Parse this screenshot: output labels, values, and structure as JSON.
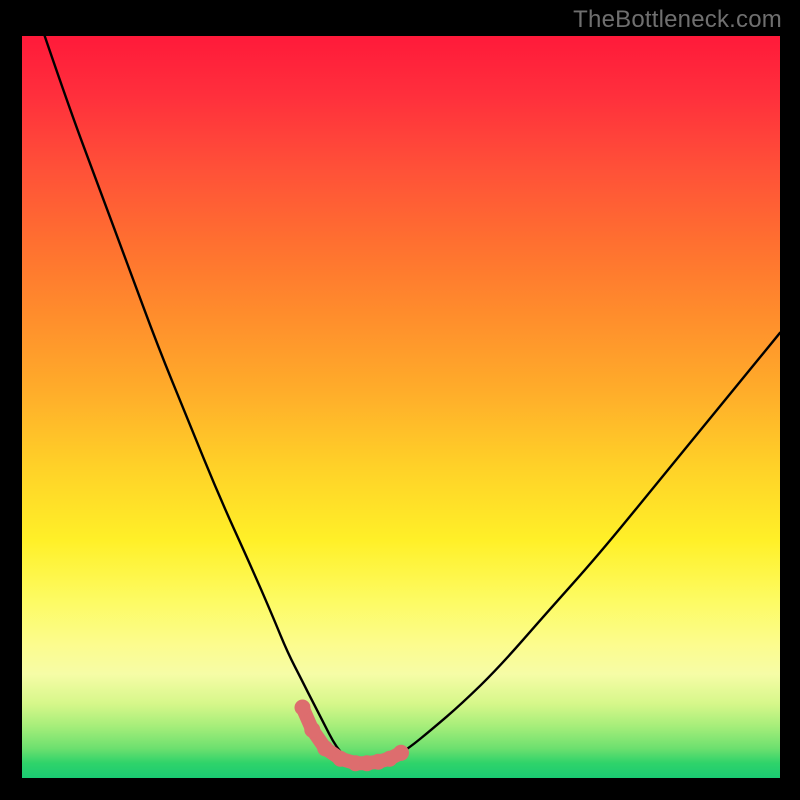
{
  "watermark": "TheBottleneck.com",
  "colors": {
    "frame": "#000000",
    "curve": "#000000",
    "markers": "#dd6d6e",
    "gradient_top": "#ff1a3a",
    "gradient_bottom": "#1aca72"
  },
  "chart_data": {
    "type": "line",
    "title": "",
    "xlabel": "",
    "ylabel": "",
    "xlim": [
      0,
      100
    ],
    "ylim": [
      0,
      100
    ],
    "grid": false,
    "series": [
      {
        "name": "bottleneck-curve",
        "x": [
          3,
          6,
          10,
          14,
          18,
          22,
          26,
          30,
          33,
          35,
          37,
          38.5,
          40,
          41,
          42,
          43,
          44,
          45,
          46,
          47,
          49,
          51,
          54,
          58,
          63,
          69,
          76,
          84,
          92,
          100
        ],
        "y": [
          100,
          91,
          80,
          69,
          58,
          48,
          38,
          29,
          22,
          17,
          13,
          10,
          7,
          5,
          3.5,
          2.5,
          2,
          2,
          2,
          2.2,
          2.8,
          4,
          6.5,
          10,
          15,
          22,
          30,
          40,
          50,
          60
        ]
      },
      {
        "name": "trough-markers",
        "x": [
          37,
          38.3,
          40,
          42,
          44,
          45.5,
          47,
          48.5,
          50
        ],
        "y": [
          9.5,
          6.5,
          4,
          2.6,
          2,
          2,
          2.2,
          2.6,
          3.4
        ]
      }
    ],
    "annotations": []
  }
}
